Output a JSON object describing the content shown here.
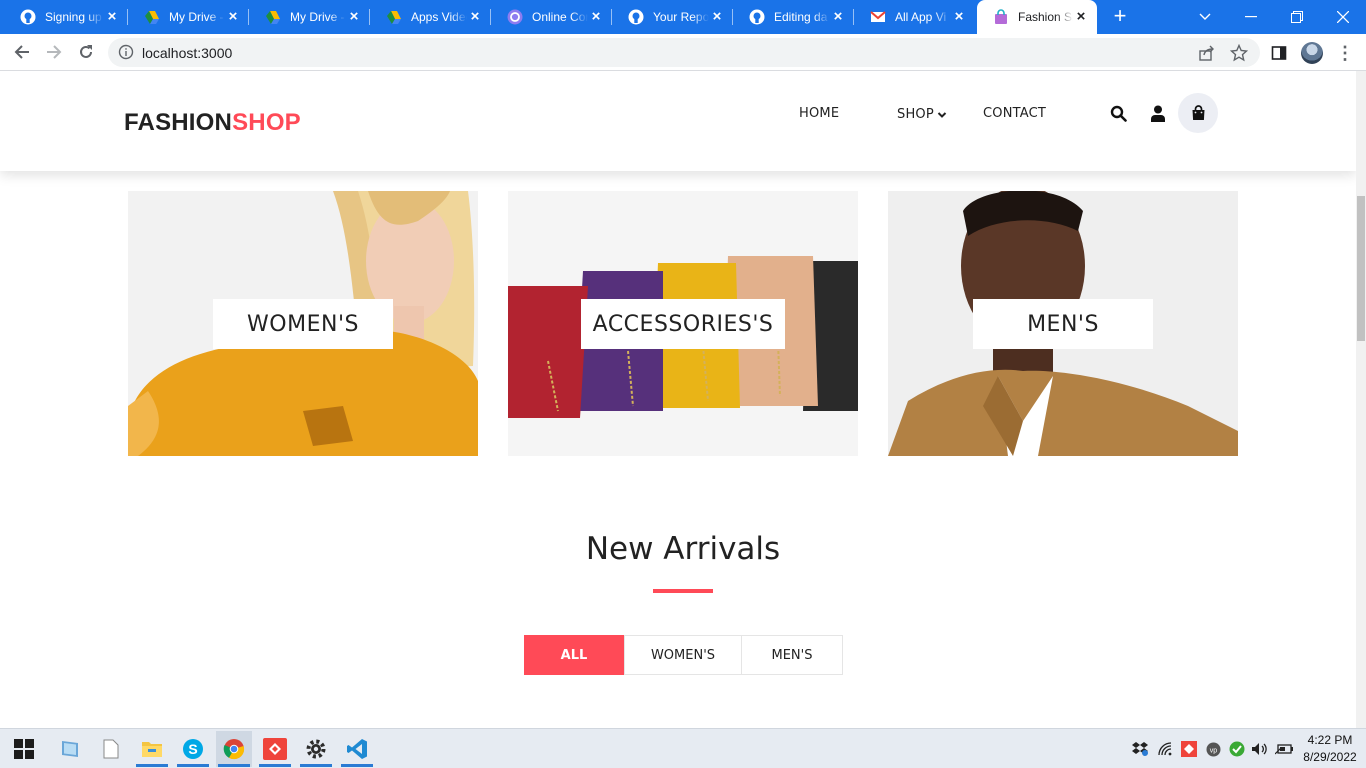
{
  "browser": {
    "tabs": [
      {
        "label": "Signing up",
        "icon": "github-icon"
      },
      {
        "label": "My Drive -",
        "icon": "google-drive-icon"
      },
      {
        "label": "My Drive -",
        "icon": "google-drive-icon"
      },
      {
        "label": "Apps Video",
        "icon": "google-drive-icon"
      },
      {
        "label": "Online Cor",
        "icon": "online-converter-icon"
      },
      {
        "label": "Your Repo",
        "icon": "github-icon"
      },
      {
        "label": "Editing da",
        "icon": "github-icon"
      },
      {
        "label": "All App Vi",
        "icon": "gmail-icon"
      },
      {
        "label": "Fashion Sh",
        "icon": "shopping-bag-icon"
      }
    ],
    "url": "localhost:3000",
    "accent": "#1a73e8"
  },
  "site": {
    "logo_part1": "FASHION",
    "logo_part2": "SHOP",
    "brand_color": "#ff4a57",
    "nav": {
      "home": "HOME",
      "shop": "SHOP",
      "contact": "CONTACT"
    },
    "categories": [
      {
        "label": "WOMEN'S"
      },
      {
        "label": "ACCESSORIES'S"
      },
      {
        "label": "MEN'S"
      }
    ],
    "new_arrivals": {
      "title": "New Arrivals",
      "filters": [
        "ALL",
        "WOMEN'S",
        "MEN'S"
      ],
      "active_filter": "ALL"
    }
  },
  "taskbar": {
    "apps": [
      "start-icon",
      "tablet-icon",
      "file-icon",
      "file-explorer-icon",
      "skype-icon",
      "chrome-icon",
      "anydesk-icon",
      "settings-icon",
      "vscode-icon"
    ],
    "time": "4:22 PM",
    "date": "8/29/2022"
  }
}
